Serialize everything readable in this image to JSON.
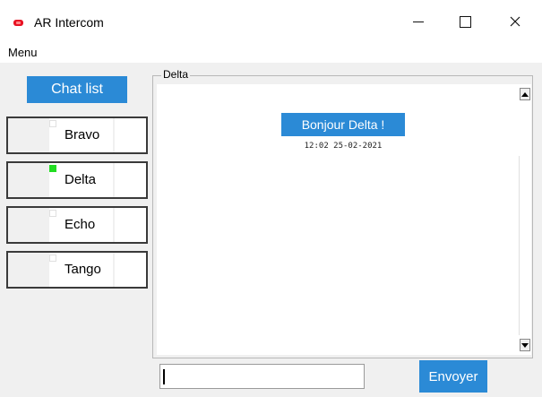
{
  "window": {
    "title": "AR Intercom",
    "icon": "app-icon",
    "controls": [
      "minimize-icon",
      "maximize-icon",
      "close-icon"
    ]
  },
  "menu": {
    "items": [
      {
        "label": "Menu"
      }
    ]
  },
  "sidebar": {
    "chat_list_label": "Chat list",
    "contacts": [
      {
        "name": "Bravo",
        "online": false
      },
      {
        "name": "Delta",
        "online": true
      },
      {
        "name": "Echo",
        "online": false
      },
      {
        "name": "Tango",
        "online": false
      }
    ]
  },
  "chat": {
    "group_title": "Delta",
    "messages": [
      {
        "text": "Bonjour Delta !",
        "timestamp": "12:02  25-02-2021"
      }
    ]
  },
  "composer": {
    "input_value": "",
    "send_label": "Envoyer"
  },
  "colors": {
    "accent": "#2b8ad6",
    "online": "#22dd22",
    "app_icon": "#e81123"
  }
}
